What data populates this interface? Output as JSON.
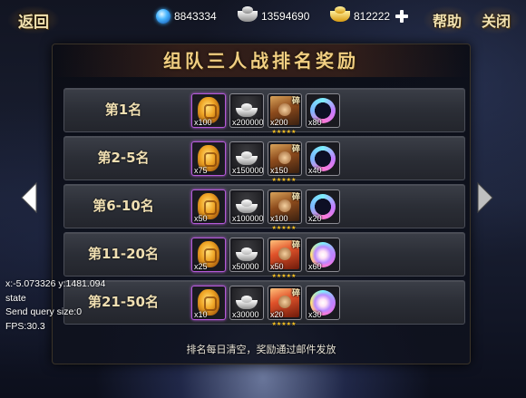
{
  "header": {
    "back_label": "返回",
    "help_label": "帮助",
    "close_label": "关闭",
    "resources": {
      "gems": "8843334",
      "silver": "13594690",
      "gold": "812222"
    }
  },
  "panel": {
    "title": "组队三人战排名奖励",
    "footer": "排名每日清空，奖励通过邮件发放",
    "rows": [
      {
        "rank": "第1名",
        "rewards": [
          {
            "icon": "golden-egg-icon",
            "qty": "x100"
          },
          {
            "icon": "silver-ingot-icon",
            "qty": "x200000"
          },
          {
            "icon": "hero-fragment-icon",
            "qty": "x200",
            "frag": "碎",
            "stars": "★★★★★"
          },
          {
            "icon": "spirit-orb-icon",
            "qty": "x80"
          }
        ]
      },
      {
        "rank": "第2-5名",
        "rewards": [
          {
            "icon": "golden-egg-icon",
            "qty": "x75"
          },
          {
            "icon": "silver-ingot-icon",
            "qty": "x150000"
          },
          {
            "icon": "hero-fragment-icon",
            "qty": "x150",
            "frag": "碎",
            "stars": "★★★★★"
          },
          {
            "icon": "spirit-orb-icon",
            "qty": "x40"
          }
        ]
      },
      {
        "rank": "第6-10名",
        "rewards": [
          {
            "icon": "golden-egg-icon",
            "qty": "x50"
          },
          {
            "icon": "silver-ingot-icon",
            "qty": "x100000"
          },
          {
            "icon": "hero-fragment-icon",
            "qty": "x100",
            "frag": "碎",
            "stars": "★★★★★"
          },
          {
            "icon": "spirit-orb-icon",
            "qty": "x20"
          }
        ]
      },
      {
        "rank": "第11-20名",
        "rewards": [
          {
            "icon": "golden-egg-icon",
            "qty": "x25"
          },
          {
            "icon": "silver-ingot-icon",
            "qty": "x50000"
          },
          {
            "icon": "hero-fragment-icon",
            "qty": "x50",
            "frag": "碎",
            "stars": "★★★★★"
          },
          {
            "icon": "spirit-orb-icon",
            "qty": "x60"
          }
        ]
      },
      {
        "rank": "第21-50名",
        "rewards": [
          {
            "icon": "golden-egg-icon",
            "qty": "x10"
          },
          {
            "icon": "silver-ingot-icon",
            "qty": "x30000"
          },
          {
            "icon": "hero-fragment-icon",
            "qty": "x20",
            "frag": "碎",
            "stars": "★★★★★"
          },
          {
            "icon": "spirit-orb-icon",
            "qty": "x30"
          }
        ]
      }
    ]
  },
  "debug": {
    "coords": "x:-5.073326 y:1481.094",
    "state": "state",
    "query": "Send query size:0",
    "fps": "FPS:30.3"
  },
  "colors": {
    "title_gold": "#f1cf82",
    "row_bg": "#2b2e36",
    "purple_frame": "#b45ad8",
    "star": "#ffc826"
  }
}
